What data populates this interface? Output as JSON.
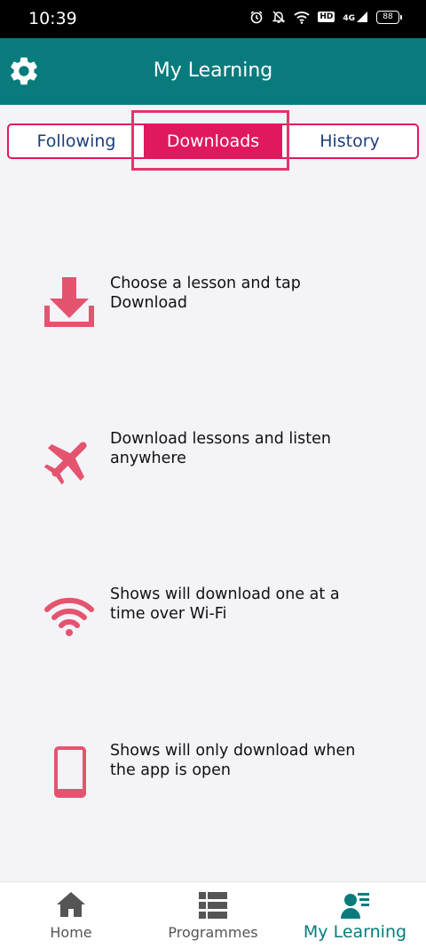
{
  "status": {
    "time": "10:39",
    "hd": "HD",
    "network": "4G",
    "battery": "88"
  },
  "header": {
    "title": "My Learning",
    "settings_icon": "gear-icon"
  },
  "tabs": [
    {
      "label": "Following",
      "active": false
    },
    {
      "label": "Downloads",
      "active": true
    },
    {
      "label": "History",
      "active": false
    }
  ],
  "features": [
    {
      "icon": "download-icon",
      "text": "Choose a lesson and tap Download"
    },
    {
      "icon": "airplane-icon",
      "text": "Download lessons and listen anywhere"
    },
    {
      "icon": "wifi-icon",
      "text": "Shows will download one at a time over Wi-Fi"
    },
    {
      "icon": "phone-icon",
      "text": "Shows will only download when the app is open"
    }
  ],
  "bottom_nav": [
    {
      "label": "Home",
      "icon": "home-icon",
      "active": false
    },
    {
      "label": "Programmes",
      "icon": "grid-list-icon",
      "active": false
    },
    {
      "label": "My Learning",
      "icon": "my-learning-icon",
      "active": true
    }
  ],
  "colors": {
    "accent": "#e0185d",
    "brand": "#097b7d",
    "icon": "#e4546f",
    "tab_text": "#1d3f7a"
  }
}
